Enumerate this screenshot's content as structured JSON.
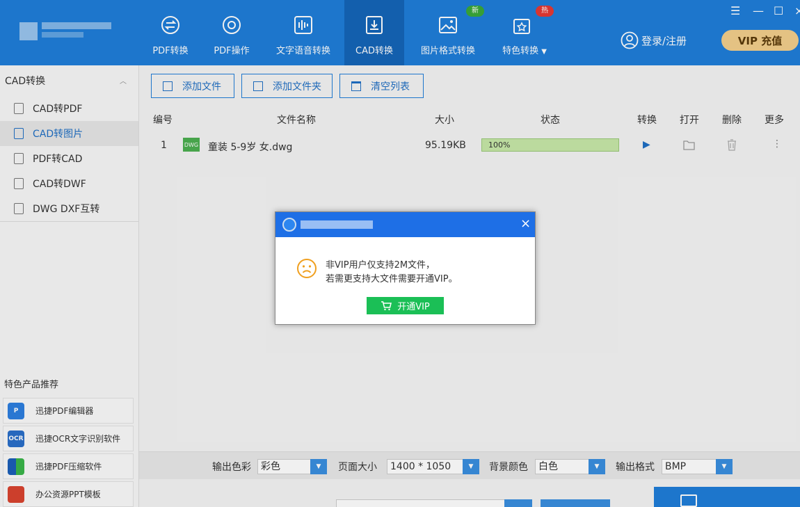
{
  "header": {
    "nav": [
      {
        "label": "PDF转换",
        "icon": "pdf-convert-icon"
      },
      {
        "label": "PDF操作",
        "icon": "pdf-operate-icon"
      },
      {
        "label": "文字语音转换",
        "icon": "text-voice-icon"
      },
      {
        "label": "CAD转换",
        "icon": "cad-convert-icon"
      },
      {
        "label": "图片格式转换",
        "icon": "image-format-icon",
        "badge": "新"
      },
      {
        "label": "特色转换",
        "icon": "special-convert-icon",
        "badge": "热"
      }
    ],
    "active_nav": "CAD转换",
    "login_label": "登录/注册",
    "vip_label": "VIP 充值",
    "colors": {
      "bar": "#1f7ed9",
      "active_tab": "#1565b8",
      "new_badge": "#3aa83a",
      "hot_badge": "#e53935",
      "vip": "#f3cf8c"
    }
  },
  "sidebar": {
    "section_title": "CAD转换",
    "items": [
      {
        "label": "CAD转PDF"
      },
      {
        "label": "CAD转图片"
      },
      {
        "label": "PDF转CAD"
      },
      {
        "label": "CAD转DWF"
      },
      {
        "label": "DWG DXF互转"
      }
    ],
    "active_item": "CAD转图片",
    "promo_title": "特色产品推荐",
    "promos": [
      {
        "label": "迅捷PDF编辑器",
        "icon": "pdf-editor-icon"
      },
      {
        "label": "迅捷OCR文字识别软件",
        "icon": "ocr-icon",
        "icon_text": "OCR"
      },
      {
        "label": "迅捷PDF压缩软件",
        "icon": "pdf-compress-icon"
      },
      {
        "label": "办公资源PPT模板",
        "icon": "ppt-template-icon"
      }
    ]
  },
  "toolbar": {
    "add_file": "添加文件",
    "add_folder": "添加文件夹",
    "clear_list": "清空列表"
  },
  "table": {
    "headers": [
      "编号",
      "文件名称",
      "大小",
      "状态",
      "转换",
      "打开",
      "删除",
      "更多"
    ],
    "rows": [
      {
        "index": "1",
        "file_type": "DWG",
        "name": "童装 5-9岁 女.dwg",
        "size": "95.19KB",
        "status": "100%",
        "progress": 1.0
      }
    ]
  },
  "options": {
    "color_label": "输出色彩",
    "color_value": "彩色",
    "page_size_label": "页面大小",
    "page_size_value": "1400 * 1050",
    "bg_label": "背景颜色",
    "bg_value": "白色",
    "format_label": "输出格式",
    "format_value": "BMP"
  },
  "dialog": {
    "message_line1": "非VIP用户仅支持2M文件，",
    "message_line2": "若需更支持大文件需要开通VIP。",
    "button_label": "开通VIP",
    "close_glyph": "×",
    "colors": {
      "title_bar": "#1e6fe6",
      "button": "#1bbf56",
      "face": "#f0a020"
    }
  }
}
